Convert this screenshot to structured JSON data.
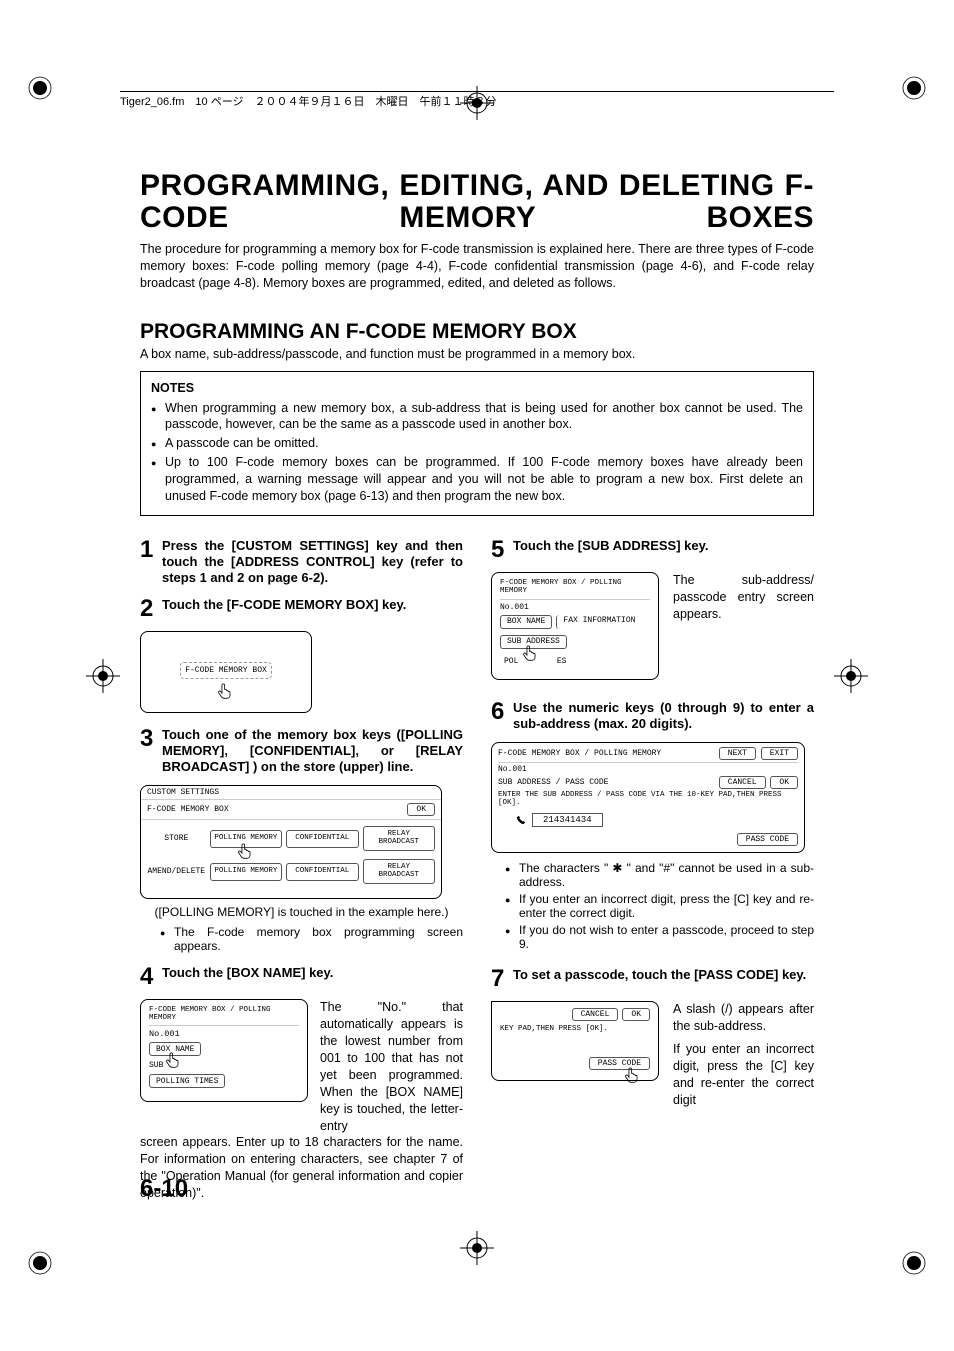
{
  "header_meta": "Tiger2_06.fm　10 ページ　２００４年９月１６日　木曜日　午前１１時８分",
  "title": "PROGRAMMING, EDITING, AND DELETING F-CODE MEMORY BOXES",
  "intro": "The procedure for programming a memory box for F-code transmission is explained here. There are three types of F-code memory boxes: F-code polling memory (page 4-4), F-code confidential transmission (page 4-6), and F-code relay broadcast (page 4-8). Memory boxes are programmed, edited, and deleted as follows.",
  "section_title": "PROGRAMMING AN F-CODE MEMORY BOX",
  "section_sub": "A box name, sub-address/passcode, and function must be programmed in a memory box.",
  "notes": {
    "title": "NOTES",
    "items": [
      "When programming a new memory box, a sub-address that is being used for another box cannot be used. The passcode, however, can be the same as a passcode used in another box.",
      "A passcode can be omitted.",
      "Up to 100 F-code memory boxes can be programmed. If 100 F-code memory boxes have already been programmed, a warning message will appear and you will not be able to program a new box. First delete an unused F-code memory box (page 6-13) and then program the new box."
    ]
  },
  "steps": {
    "s1": "Press the [CUSTOM SETTINGS] key and then touch the [ADDRESS CONTROL] key (refer to steps 1 and 2 on page 6-2).",
    "s2": "Touch the [F-CODE MEMORY BOX] key.",
    "screen2_label": "F-CODE MEMORY BOX",
    "s3": "Touch one of the memory box keys ([POLLING MEMORY], [CONFIDENTIAL], or [RELAY BROADCAST] ) on the store (upper) line.",
    "screen3": {
      "custom": "CUSTOM SETTINGS",
      "title": "F-CODE MEMORY BOX",
      "ok": "OK",
      "store": "STORE",
      "amend": "AMEND/DELETE",
      "polling": "POLLING MEMORY",
      "confidential": "CONFIDENTIAL",
      "relay": "RELAY\nBROADCAST"
    },
    "s3_note1": "([POLLING MEMORY] is touched in the example here.)",
    "s3_note2": "The F-code memory box programming screen appears.",
    "s4": "Touch the [BOX NAME] key.",
    "screen4": {
      "path": "F-CODE MEMORY BOX / POLLING MEMORY",
      "no": "No.001",
      "boxname": "BOX NAME",
      "sub": "SUB",
      "polling_times": "POLLING TIMES"
    },
    "s4_para": "The \"No.\" that automatically appears is the lowest number from 001 to 100 that has not yet been programmed. When the [BOX NAME] key is touched, the letter-entry screen appears. Enter up to 18 characters for the name. For information on entering characters, see chapter 7 of the \"Operation Manual (for general information and copier operation)\".",
    "s5": "Touch the [SUB ADDRESS] key.",
    "screen5": {
      "path": "F-CODE MEMORY BOX / POLLING MEMORY",
      "no": "No.001",
      "boxname": "BOX NAME",
      "faxinfo": "FAX INFORMATION",
      "subaddr": "SUB ADDRESS",
      "polling": "POLLING TIMES"
    },
    "s5_para": "The sub-address/ passcode entry screen appears.",
    "s6": "Use the numeric keys (0 through 9) to enter a sub-address (max. 20 digits).",
    "screen6": {
      "path": "F-CODE MEMORY BOX / POLLING MEMORY",
      "next": "NEXT",
      "exit": "EXIT",
      "no": "No.001",
      "line": "SUB ADDRESS / PASS CODE",
      "cancel": "CANCEL",
      "ok": "OK",
      "msg": "ENTER THE SUB ADDRESS / PASS CODE VIA THE 10-KEY PAD,THEN PRESS [OK].",
      "value": "214341434",
      "passcode": "PASS CODE"
    },
    "s6_bullets": [
      "The characters \" ✱ \" and \"#\" cannot be used in a sub-address.",
      "If you enter an incorrect digit, press the [C] key and re-enter the correct digit.",
      "If you do not wish to enter a passcode, proceed to step 9."
    ],
    "s7": "To set a passcode, touch the [PASS CODE] key.",
    "screen7": {
      "cancel": "CANCEL",
      "ok": "OK",
      "msg": "KEY PAD,THEN PRESS [OK].",
      "passcode": "PASS CODE"
    },
    "s7_para1": "A slash (/) appears after the sub-address.",
    "s7_para2": "If you enter an incorrect digit, press the [C] key and re-enter the correct digit"
  },
  "page_number": "6-10"
}
